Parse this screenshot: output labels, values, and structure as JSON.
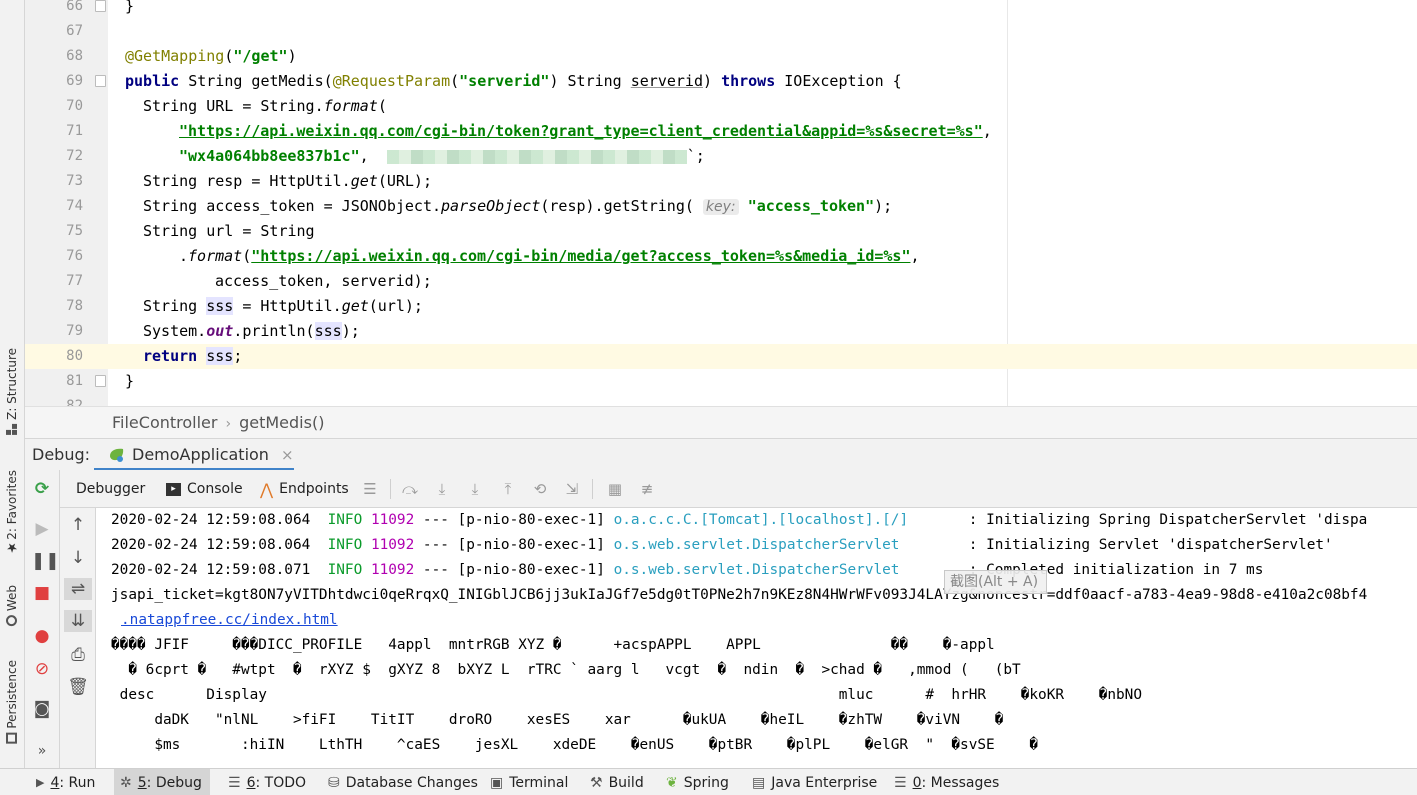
{
  "editor": {
    "lines": [
      {
        "n": "66",
        "fold": true
      },
      {
        "n": "67"
      },
      {
        "n": "68"
      },
      {
        "n": "69",
        "fold": true
      },
      {
        "n": "70"
      },
      {
        "n": "71"
      },
      {
        "n": "72"
      },
      {
        "n": "73"
      },
      {
        "n": "74"
      },
      {
        "n": "75"
      },
      {
        "n": "76"
      },
      {
        "n": "77"
      },
      {
        "n": "78"
      },
      {
        "n": "79"
      },
      {
        "n": "80",
        "current": true
      },
      {
        "n": "81",
        "fold": true
      },
      {
        "n": "82"
      }
    ],
    "code": {
      "l66": "}",
      "l68_ann": "@GetMapping",
      "l68_paren_open": "(",
      "l68_str": "\"/get\"",
      "l68_paren_close": ")",
      "l69_kw": "public",
      "l69_a": " String getMedis(",
      "l69_ann": "@RequestParam",
      "l69_b": "(",
      "l69_str": "\"serverid\"",
      "l69_c": ") String ",
      "l69_param": "serverid",
      "l69_d": ") ",
      "l69_kw2": "throws",
      "l69_e": " IOException {",
      "l70_a": "String URL = String.",
      "l70_it": "format",
      "l70_b": "(",
      "l71_url": "\"https://api.weixin.qq.com/cgi-bin/token?grant_type=client_credential&appid=%s&secret=%s\"",
      "l71_comma": ",",
      "l72_str": "\"wx4a064bb8ee837b1c\"",
      "l72_comma": ",",
      "l72_tail": "`;",
      "l73_a": "String resp = HttpUtil.",
      "l73_it": "get",
      "l73_b": "(URL);",
      "l74_a": "String access_token = JSONObject.",
      "l74_it": "parseObject",
      "l74_b": "(resp).getString(",
      "l74_hint": "key:",
      "l74_str": "\"access_token\"",
      "l74_c": ");",
      "l75": "String url = String",
      "l76_dot": ".",
      "l76_it": "format",
      "l76_paren": "(",
      "l76_url": "\"https://api.weixin.qq.com/cgi-bin/media/get?access_token=%s&media_id=%s\"",
      "l76_comma": ",",
      "l77": "access_token, serverid);",
      "l78_a": "String ",
      "l78_var": "sss",
      "l78_b": " = HttpUtil.",
      "l78_it": "get",
      "l78_c": "(url);",
      "l79_a": "System.",
      "l79_out": "out",
      "l79_b": ".println(",
      "l79_var": "sss",
      "l79_c": ");",
      "l80_kw": "return",
      "l80_sp": " ",
      "l80_var": "sss",
      "l80_semi": ";",
      "l81": "}"
    }
  },
  "breadcrumb": {
    "items": [
      "FileController",
      "getMedis()"
    ]
  },
  "debug": {
    "label": "Debug:",
    "session": "DemoApplication",
    "close": "×",
    "tabs": [
      "Debugger",
      "Console",
      "Endpoints"
    ]
  },
  "console": {
    "logs": [
      {
        "time": "2020-02-24 12:59:08.064",
        "level": "INFO",
        "pid": "11092",
        "sep": " --- ",
        "thread": "[p-nio-80-exec-1]",
        "logger": "o.a.c.c.C.[Tomcat].[localhost].[/]",
        "msg": ": Initializing Spring DispatcherServlet 'dispa"
      },
      {
        "time": "2020-02-24 12:59:08.064",
        "level": "INFO",
        "pid": "11092",
        "sep": " --- ",
        "thread": "[p-nio-80-exec-1]",
        "logger": "o.s.web.servlet.DispatcherServlet",
        "msg": ": Initializing Servlet 'dispatcherServlet'"
      },
      {
        "time": "2020-02-24 12:59:08.071",
        "level": "INFO",
        "pid": "11092",
        "sep": " --- ",
        "thread": "[p-nio-80-exec-1]",
        "logger": "o.s.web.servlet.DispatcherServlet",
        "msg": ": Completed initialization in 7 ms"
      }
    ],
    "ticket_line": "jsapi_ticket=kgt8ON7yVITDhtdwci0qeRrqxQ_INIGblJCB6jj3ukIaJGf7e5dg0tT0PNe2h7n9KEz8N4HWrWFv093J4LAYzg&noncestr=ddf0aacf-a783-4ea9-98d8-e410a2c08bf4",
    "link": ".natappfree.cc/index.html",
    "binary": [
      "���� \u0010JFIF \u0001\u0001 \u0001 \u0001  ���\u0002DICC_PROFILE \u0001\u0001  \u00024appl\u0004\u0000  mntrRGB XYZ �\u0007 \u0006 \u0019   \u0001 +acspAPPL    APPL               �� \u0001   �-appl",
      "  \u0011� \u00106cprt \u0001�   #wtpt  \u0001�  \u0014rXYZ \u0002$  \u0014gXYZ \u00028  \u0014bXYZ \u0002L  \u0014rTRC \u0002` \u0010aarg \u0002l   vcgt  \u0002�  \u0010ndin  \u0003�  \u0003>chad \u0003�   ,mmod \u0004(   (bT",
      " desc      Display                                                                  mluc      #  \u0001\fhrHR  \u0001  \u0014�koKR  \u0001  \u0014�nbNO",
      "   \u0001  \u0014daDK  \u0001 \u0001\"nlNL  \u0001  \u0001>fiFI  \u0001  \u0001TitIT  \u0001  \u0001droRO  \u0001  \u0001xesES  \u0001  \u0001xar    \u0001  \u0001�ukUA  \u0001  \u0001�heIL  \u0001  \u0001�zhTW  \u0001  \u0001�viVN  \u0001  \u0001�",
      "   \u0001  \u0001$ms     \u0001  \u0001:hiIN  \u0001  \u0001LthTH  \u0001  \u0001^caES  \u0001  \u0001jesXL  \u0001  \u0001xdeDE  \u0001  \u0001�enUS  \u0001  \u0001�ptBR  \u0001  \u0001�plPL  \u0001  \u0001�elGR  \"  \u0001�svSE  \u0001  \u0001�"
    ]
  },
  "tooltip": "截图(Alt + A)",
  "left_strip": [
    "Z: Structure",
    "2: Favorites",
    "Web",
    "Persistence"
  ],
  "bottombar": [
    {
      "key": "4",
      "label": ": Run",
      "icon": "run-icon"
    },
    {
      "key": "5",
      "label": ": Debug",
      "icon": "bug-icon",
      "active": true
    },
    {
      "key": "6",
      "label": ": TODO",
      "icon": "todo-icon"
    },
    {
      "key": "",
      "label": "Database Changes",
      "icon": "database-icon"
    },
    {
      "key": "",
      "label": "Terminal",
      "icon": "terminal-icon"
    },
    {
      "key": "",
      "label": "Build",
      "icon": "hammer-icon"
    },
    {
      "key": "",
      "label": "Spring",
      "icon": "spring-icon"
    },
    {
      "key": "",
      "label": "Java Enterprise",
      "icon": "java-enterprise-icon"
    },
    {
      "key": "0",
      "label": ": Messages",
      "icon": "messages-icon"
    }
  ],
  "colors": {
    "accent": "#4083c9",
    "keyword": "#000080",
    "string": "#008000",
    "annotation": "#808000",
    "info": "#0a9a2a",
    "caret_line": "#fffae3"
  }
}
